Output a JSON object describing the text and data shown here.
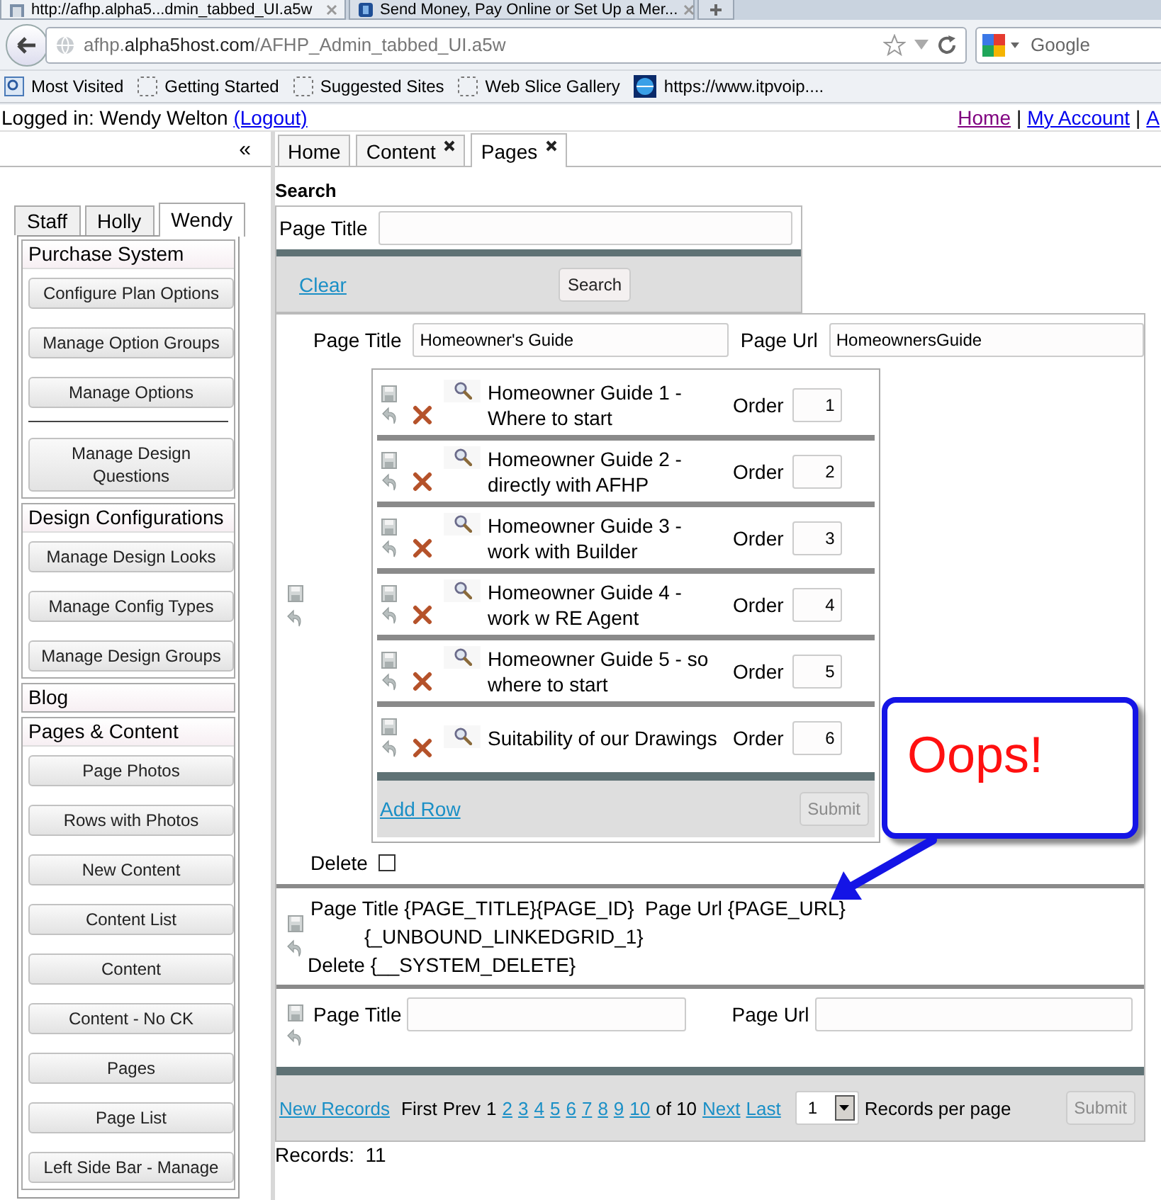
{
  "browser": {
    "tabs": [
      {
        "title": "http://afhp.alpha5...dmin_tabbed_UI.a5w",
        "selected": true
      },
      {
        "title": "Send Money, Pay Online or Set Up a Mer...",
        "selected": false
      }
    ],
    "address": "afhp.**alpha5host.com**/AFHP_Admin_tabbed_UI.a5w",
    "search_placeholder": "Google",
    "bookmarks": [
      {
        "label": "Most Visited",
        "kind": "smart"
      },
      {
        "label": "Getting Started",
        "kind": "blank"
      },
      {
        "label": "Suggested Sites",
        "kind": "blank"
      },
      {
        "label": "Web Slice Gallery",
        "kind": "blank"
      },
      {
        "label": "https://www.itpvoip....",
        "kind": "site"
      }
    ]
  },
  "header": {
    "logged_in": "Logged in: Wendy Welton",
    "logout": "(Logout)",
    "links": [
      {
        "label": "Home",
        "visited": true
      },
      {
        "label": "My Account",
        "visited": false
      },
      {
        "label": "A",
        "visited": false
      }
    ],
    "separators": [
      "|",
      "|"
    ]
  },
  "sidebar": {
    "collapse": "«",
    "tabs": [
      {
        "label": "Staff",
        "selected": false
      },
      {
        "label": "Holly",
        "selected": false
      },
      {
        "label": "Wendy",
        "selected": true
      }
    ],
    "sections": [
      {
        "title": "Purchase System",
        "items": [
          {
            "kind": "button",
            "label": "Configure Plan Options"
          },
          {
            "kind": "button",
            "label": "Manage Option Groups"
          },
          {
            "kind": "button",
            "label": "Manage Options"
          },
          {
            "kind": "divider"
          },
          {
            "kind": "button",
            "label": "Manage Design Questions"
          }
        ]
      },
      {
        "title": "Design Configurations",
        "items": [
          {
            "kind": "button",
            "label": "Manage Design Looks"
          },
          {
            "kind": "button",
            "label": "Manage Config Types"
          },
          {
            "kind": "button",
            "label": "Manage Design Groups"
          }
        ]
      },
      {
        "title": "Blog"
      },
      {
        "title": "Pages & Content",
        "items": [
          {
            "kind": "button",
            "label": "Page Photos"
          },
          {
            "kind": "button",
            "label": "Rows with Photos"
          },
          {
            "kind": "button",
            "label": "New Content"
          },
          {
            "kind": "button",
            "label": "Content List"
          },
          {
            "kind": "button",
            "label": "Content"
          },
          {
            "kind": "button",
            "label": "Content - No CK"
          },
          {
            "kind": "button",
            "label": "Pages"
          },
          {
            "kind": "button",
            "label": "Page List"
          },
          {
            "kind": "button",
            "label": "Left Side Bar - Manage"
          }
        ]
      }
    ]
  },
  "main_tabs": [
    {
      "label": "Home",
      "closable": false,
      "selected": false
    },
    {
      "label": "Content",
      "closable": true,
      "selected": false
    },
    {
      "label": "Pages",
      "closable": true,
      "selected": true
    }
  ],
  "search": {
    "title": "Search",
    "field_label": "Page Title",
    "clear": "Clear",
    "button": "Search"
  },
  "record": {
    "title_label": "Page Title",
    "title_value": "Homeowner's Guide",
    "url_label": "Page Url",
    "url_value": "HomeownersGuide",
    "linked_rows": [
      {
        "title": "Homeowner Guide 1 - Where to start",
        "order_label": "Order",
        "order": "1"
      },
      {
        "title": "Homeowner Guide 2 - directly with AFHP",
        "order_label": "Order",
        "order": "2"
      },
      {
        "title": "Homeowner Guide 3 - work with Builder",
        "order_label": "Order",
        "order": "3"
      },
      {
        "title": "Homeowner Guide 4 - work w RE Agent",
        "order_label": "Order",
        "order": "4"
      },
      {
        "title": "Homeowner Guide 5 - so where to start",
        "order_label": "Order",
        "order": "5"
      },
      {
        "title": "Suitability of our Drawings",
        "order_label": "Order",
        "order": "6"
      }
    ],
    "add_row": "Add Row",
    "submit": {
      "label": "Submit",
      "disabled": true
    },
    "delete_label": "Delete",
    "delete_checked": false
  },
  "template": {
    "line_1": "Page Title {PAGE_TITLE}{PAGE_ID}  Page Url {PAGE_URL}",
    "line_2": "{_UNBOUND_LINKEDGRID_1}",
    "line_3": "Delete {__SYSTEM_DELETE}"
  },
  "new_record": {
    "title_label": "Page Title",
    "url_label": "Page Url"
  },
  "pager": {
    "new_records": "New Records",
    "first": "First",
    "prev": "Prev",
    "current": "1",
    "pages": [
      "2",
      "3",
      "4",
      "5",
      "6",
      "7",
      "8",
      "9",
      "10"
    ],
    "of": "of 10",
    "next": "Next",
    "last": "Last",
    "per_page_value": "1",
    "per_page_label": "Records per page",
    "submit": {
      "label": "Submit",
      "disabled": true
    }
  },
  "records": "Records:  11",
  "callout": {
    "text": "Oops!"
  }
}
